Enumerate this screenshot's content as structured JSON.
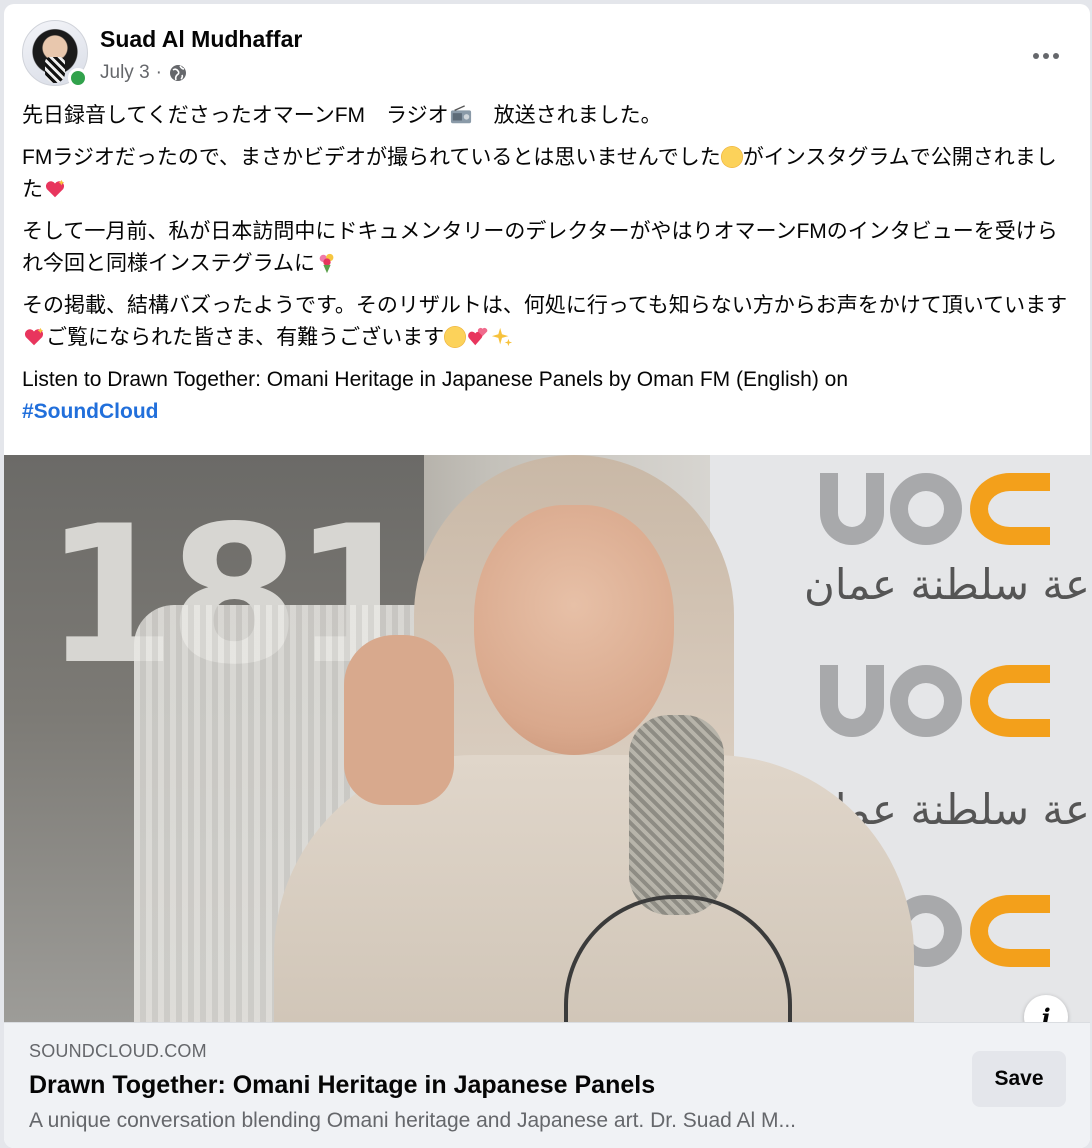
{
  "post": {
    "author": "Suad Al Mudhaffar",
    "date": "July 3",
    "separator": "·",
    "paragraphs": {
      "p1_a": "先日録音してくださったオマーンFM　ラジオ",
      "p1_b": "　放送されました。",
      "p2_a": "FMラジオだったので、まさかビデオが撮られているとは思いませんでした",
      "p2_b": "がインスタグラムで公開されました",
      "p3_a": "そして一月前、私が日本訪問中にドキュメンタリーのデレクターがやはりオマーンFMのインタビューを受けられ今回と同様インステグラムに",
      "p4_a": "その掲載、結構バズったようです。そのリザルトは、何処に行っても知らない方からお声をかけて頂いています",
      "p4_b": "ご覧になられた皆さま、有難うございます",
      "p5_a": "Listen to Drawn Together: Omani Heritage in Japanese Panels by Oman FM (English) on",
      "hashtag": "#SoundCloud"
    }
  },
  "media": {
    "studio_sign": "181",
    "logo_text": "عة سلطنة عمان",
    "info_label": "i"
  },
  "link_preview": {
    "domain": "SOUNDCLOUD.COM",
    "title": "Drawn Together: Omani Heritage in Japanese Panels",
    "description": "A unique conversation blending Omani heritage and Japanese art. Dr. Suad Al M...",
    "save_label": "Save"
  },
  "colors": {
    "link": "#216fdb",
    "secondary_text": "#65676b",
    "online": "#31a24c",
    "logo_orange": "#f3a01b"
  },
  "icons": [
    "globe-icon",
    "more-options-icon",
    "info-icon",
    "radio-emoji",
    "smile-emoji",
    "sparkling-heart-emoji",
    "bouquet-emoji",
    "laugh-emoji",
    "hearts-emoji",
    "sparkles-emoji"
  ]
}
